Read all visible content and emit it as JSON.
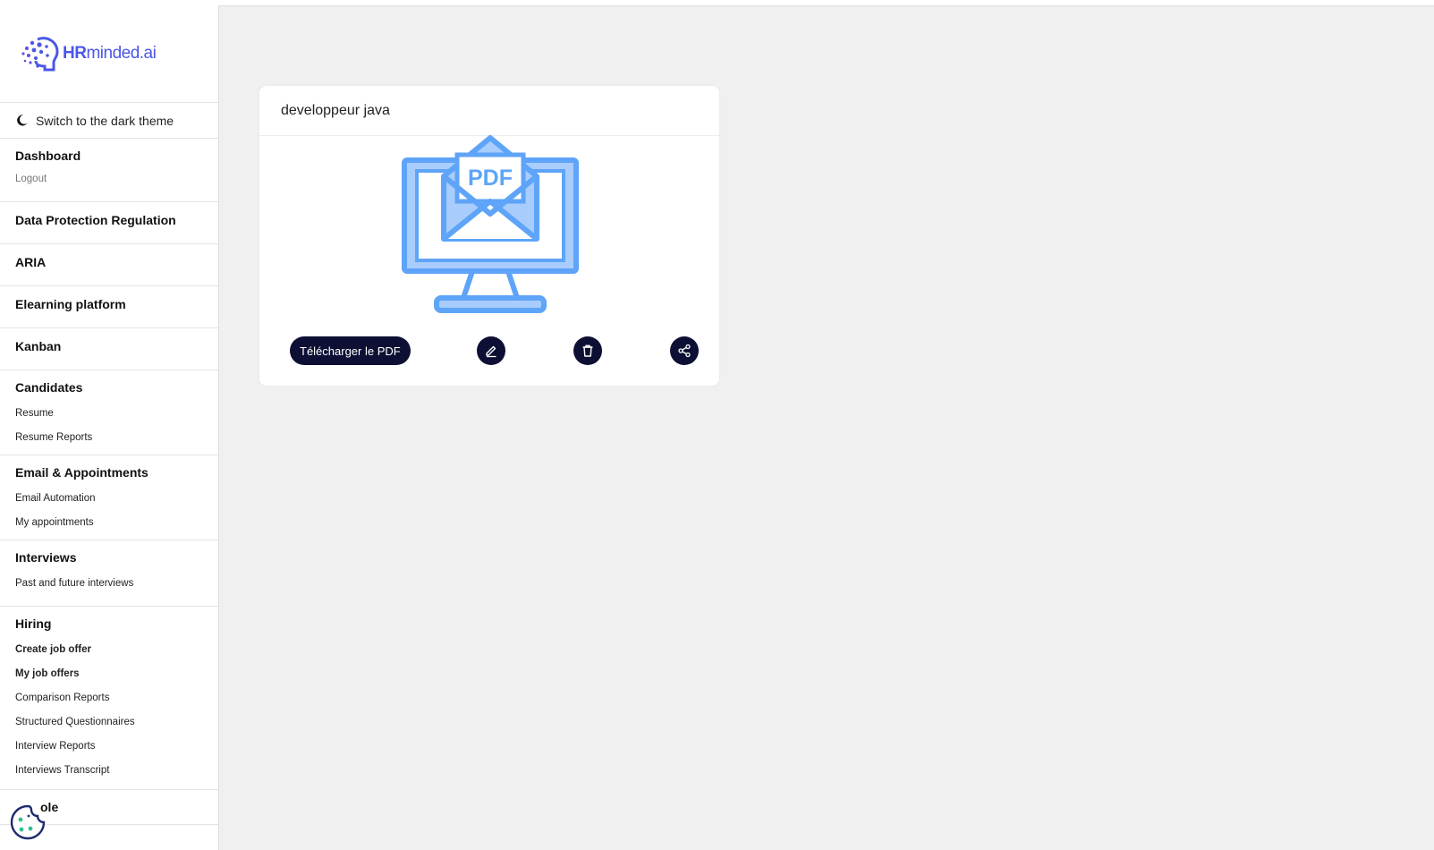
{
  "brand": {
    "logo_bold": "HR",
    "logo_rest": "minded.ai"
  },
  "theme_toggle": {
    "label": "Switch to the dark theme",
    "icon": "moon-icon"
  },
  "sidebar": {
    "dashboard": {
      "title": "Dashboard",
      "items": [
        "Logout"
      ]
    },
    "data_protection": {
      "title": "Data Protection Regulation"
    },
    "aria": {
      "title": "ARIA"
    },
    "elearning": {
      "title": "Elearning platform"
    },
    "kanban": {
      "title": "Kanban"
    },
    "candidates": {
      "title": "Candidates",
      "items": [
        "Resume",
        "Resume Reports"
      ]
    },
    "email": {
      "title": "Email & Appointments",
      "items": [
        "Email Automation",
        "My appointments"
      ]
    },
    "interviews": {
      "title": "Interviews",
      "items": [
        "Past and future interviews"
      ]
    },
    "hiring": {
      "title": "Hiring",
      "items": [
        "Create job offer",
        "My job offers",
        "Comparison Reports",
        "Structured Questionnaires",
        "Interview Reports",
        "Interviews Transcript"
      ]
    },
    "partial": {
      "title": "ole"
    }
  },
  "card": {
    "title": "developpeur java",
    "illustration_label": "PDF",
    "download_label": "Télécharger le PDF",
    "icons": [
      "edit-icon",
      "trash-icon",
      "share-icon"
    ]
  },
  "colors": {
    "accent": "#4a57e8",
    "button_dark": "#0d1034",
    "illustration": "#5ea4f8",
    "illustration_light": "#a8cdfc"
  }
}
